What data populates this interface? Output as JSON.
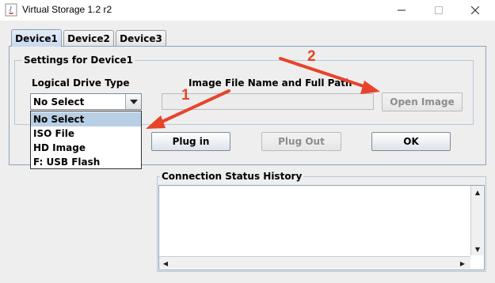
{
  "window": {
    "title": "Virtual Storage 1.2 r2"
  },
  "tabs": [
    {
      "label": "Device1",
      "active": true
    },
    {
      "label": "Device2",
      "active": false
    },
    {
      "label": "Device3",
      "active": false
    }
  ],
  "settings": {
    "group_title": "Settings for Device1",
    "logical_drive_label": "Logical Drive Type",
    "image_path_label": "Image File Name and Full Path",
    "drive_type_selected": "No Select",
    "drive_type_options": [
      "No Select",
      "ISO File",
      "HD Image",
      "F: USB Flash"
    ],
    "image_path_value": "",
    "open_image_label": "Open Image"
  },
  "buttons": {
    "plug_in": "Plug in",
    "plug_out": "Plug Out",
    "ok": "OK"
  },
  "status": {
    "group_title": "Connection Status History",
    "content": ""
  },
  "annotations": {
    "arrow_1_label": "1",
    "arrow_2_label": "2",
    "color": "#e8432a"
  },
  "icons": {
    "app": "java-cup-icon",
    "minimize": "minimize-icon",
    "maximize": "maximize-icon",
    "close": "close-icon",
    "combo_arrow": "chevron-down-icon"
  }
}
